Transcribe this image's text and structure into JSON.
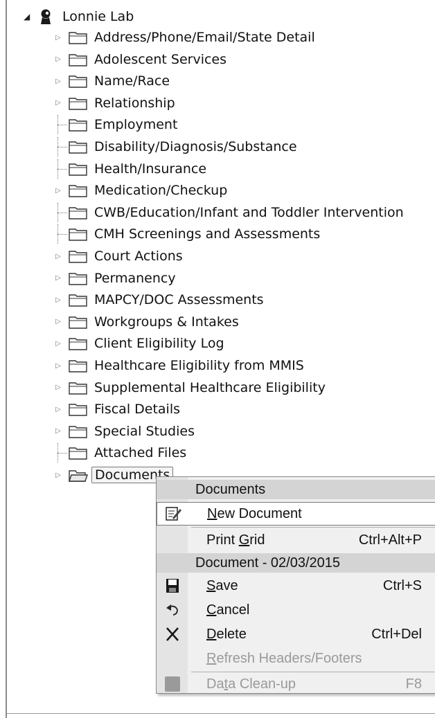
{
  "tree": {
    "root": {
      "label": "Lonnie Lab",
      "icon": "person-icon"
    },
    "items": [
      {
        "label": "Address/Phone/Email/State Detail",
        "expandable": true
      },
      {
        "label": "Adolescent Services",
        "expandable": true
      },
      {
        "label": "Name/Race",
        "expandable": true
      },
      {
        "label": "Relationship",
        "expandable": true
      },
      {
        "label": "Employment",
        "expandable": false
      },
      {
        "label": "Disability/Diagnosis/Substance",
        "expandable": false
      },
      {
        "label": "Health/Insurance",
        "expandable": false
      },
      {
        "label": "Medication/Checkup",
        "expandable": true
      },
      {
        "label": "CWB/Education/Infant and Toddler Intervention",
        "expandable": false
      },
      {
        "label": "CMH Screenings and Assessments",
        "expandable": false
      },
      {
        "label": "Court Actions",
        "expandable": true
      },
      {
        "label": "Permanency",
        "expandable": true
      },
      {
        "label": "MAPCY/DOC Assessments",
        "expandable": true
      },
      {
        "label": "Workgroups & Intakes",
        "expandable": true
      },
      {
        "label": "Client Eligibility Log",
        "expandable": true
      },
      {
        "label": "Healthcare Eligibility from MMIS",
        "expandable": true
      },
      {
        "label": "Supplemental Healthcare Eligibility",
        "expandable": true
      },
      {
        "label": "Fiscal Details",
        "expandable": true
      },
      {
        "label": "Special Studies",
        "expandable": true
      },
      {
        "label": "Attached Files",
        "expandable": false
      },
      {
        "label": "Documents",
        "expandable": true,
        "selected": true,
        "open_folder": true
      }
    ]
  },
  "menu": {
    "section1": "Documents",
    "new_document": {
      "prefix": "",
      "mnemonic": "N",
      "rest": "ew Document",
      "icon": "edit-document-icon"
    },
    "print_grid": {
      "prefix": "Print ",
      "mnemonic": "G",
      "rest": "rid",
      "shortcut": "Ctrl+Alt+P"
    },
    "section2": "Document - 02/03/2015",
    "save": {
      "prefix": "",
      "mnemonic": "S",
      "rest": "ave",
      "shortcut": "Ctrl+S",
      "icon": "save-icon"
    },
    "cancel": {
      "prefix": "",
      "mnemonic": "C",
      "rest": "ancel",
      "icon": "undo-icon"
    },
    "delete": {
      "prefix": "",
      "mnemonic": "D",
      "rest": "elete",
      "shortcut": "Ctrl+Del",
      "icon": "delete-x-icon"
    },
    "refresh": {
      "prefix": "",
      "mnemonic": "R",
      "rest": "efresh Headers/Footers"
    },
    "cleanup": {
      "prefix": "Da",
      "mnemonic": "t",
      "rest": "a Clean-up",
      "shortcut": "F8",
      "icon": "grey-square-icon"
    }
  }
}
